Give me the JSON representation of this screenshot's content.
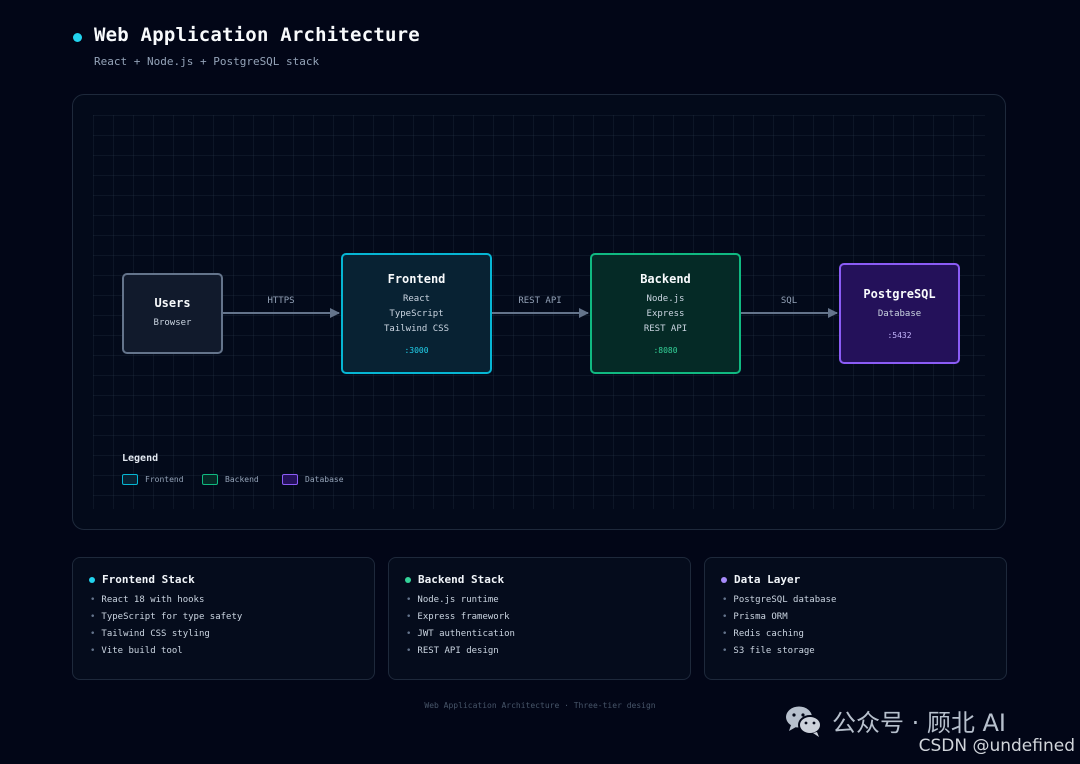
{
  "header": {
    "title": "Web Application Architecture",
    "subtitle": "React + Node.js + PostgreSQL stack"
  },
  "diagram": {
    "nodes": {
      "users": {
        "title": "Users",
        "lines": [
          "Browser"
        ]
      },
      "frontend": {
        "title": "Frontend",
        "lines": [
          "React",
          "TypeScript",
          "Tailwind CSS"
        ],
        "port": ":3000"
      },
      "backend": {
        "title": "Backend",
        "lines": [
          "Node.js",
          "Express",
          "REST API"
        ],
        "port": ":8080"
      },
      "database": {
        "title": "PostgreSQL",
        "lines": [
          "Database"
        ],
        "port": ":5432"
      }
    },
    "edges": [
      {
        "from": "Users",
        "to": "Frontend",
        "label": "HTTPS"
      },
      {
        "from": "Frontend",
        "to": "Backend",
        "label": "REST API"
      },
      {
        "from": "Backend",
        "to": "PostgreSQL",
        "label": "SQL"
      }
    ],
    "legend": {
      "title": "Legend",
      "items": [
        "Frontend",
        "Backend",
        "Database"
      ]
    }
  },
  "cards": [
    {
      "title": "Frontend Stack",
      "items": [
        "React 18 with hooks",
        "TypeScript for type safety",
        "Tailwind CSS styling",
        "Vite build tool"
      ]
    },
    {
      "title": "Backend Stack",
      "items": [
        "Node.js runtime",
        "Express framework",
        "JWT authentication",
        "REST API design"
      ]
    },
    {
      "title": "Data Layer",
      "items": [
        "PostgreSQL database",
        "Prisma ORM",
        "Redis caching",
        "S3 file storage"
      ]
    }
  ],
  "footer": {
    "text": "Web Application Architecture · Three-tier design"
  },
  "watermark": {
    "text": "公众号 · 顾北 AI",
    "csdn": "CSDN @undefined"
  },
  "colors": {
    "frontend": "#06b6d4",
    "backend": "#10b981",
    "database": "#8b5cf6",
    "users": "#64748b",
    "background": "#020617"
  }
}
